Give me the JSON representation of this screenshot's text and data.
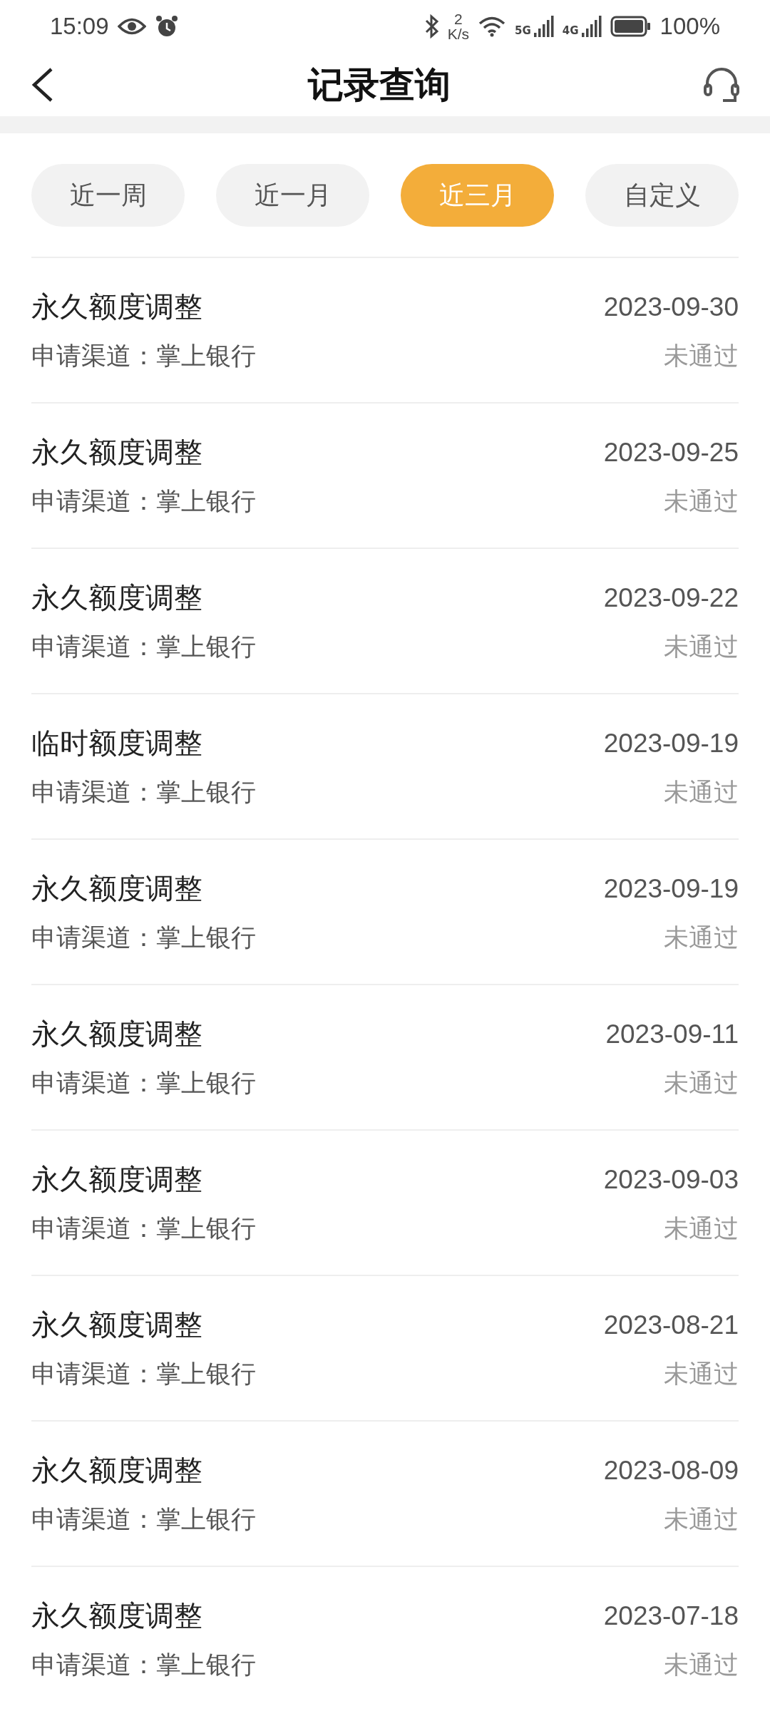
{
  "status_bar": {
    "time": "15:09",
    "speed_value": "2",
    "speed_unit": "K/s",
    "network_1": "5G",
    "network_2": "4G",
    "battery": "100%"
  },
  "header": {
    "title": "记录查询"
  },
  "tabs": [
    {
      "label": "近一周",
      "selected": false
    },
    {
      "label": "近一月",
      "selected": false
    },
    {
      "label": "近三月",
      "selected": true
    },
    {
      "label": "自定义",
      "selected": false
    }
  ],
  "records": [
    {
      "title": "永久额度调整",
      "date": "2023-09-30",
      "channel": "申请渠道：掌上银行",
      "status": "未通过"
    },
    {
      "title": "永久额度调整",
      "date": "2023-09-25",
      "channel": "申请渠道：掌上银行",
      "status": "未通过"
    },
    {
      "title": "永久额度调整",
      "date": "2023-09-22",
      "channel": "申请渠道：掌上银行",
      "status": "未通过"
    },
    {
      "title": "临时额度调整",
      "date": "2023-09-19",
      "channel": "申请渠道：掌上银行",
      "status": "未通过"
    },
    {
      "title": "永久额度调整",
      "date": "2023-09-19",
      "channel": "申请渠道：掌上银行",
      "status": "未通过"
    },
    {
      "title": "永久额度调整",
      "date": "2023-09-11",
      "channel": "申请渠道：掌上银行",
      "status": "未通过"
    },
    {
      "title": "永久额度调整",
      "date": "2023-09-03",
      "channel": "申请渠道：掌上银行",
      "status": "未通过"
    },
    {
      "title": "永久额度调整",
      "date": "2023-08-21",
      "channel": "申请渠道：掌上银行",
      "status": "未通过"
    },
    {
      "title": "永久额度调整",
      "date": "2023-08-09",
      "channel": "申请渠道：掌上银行",
      "status": "未通过"
    },
    {
      "title": "永久额度调整",
      "date": "2023-07-18",
      "channel": "申请渠道：掌上银行",
      "status": "未通过"
    }
  ]
}
